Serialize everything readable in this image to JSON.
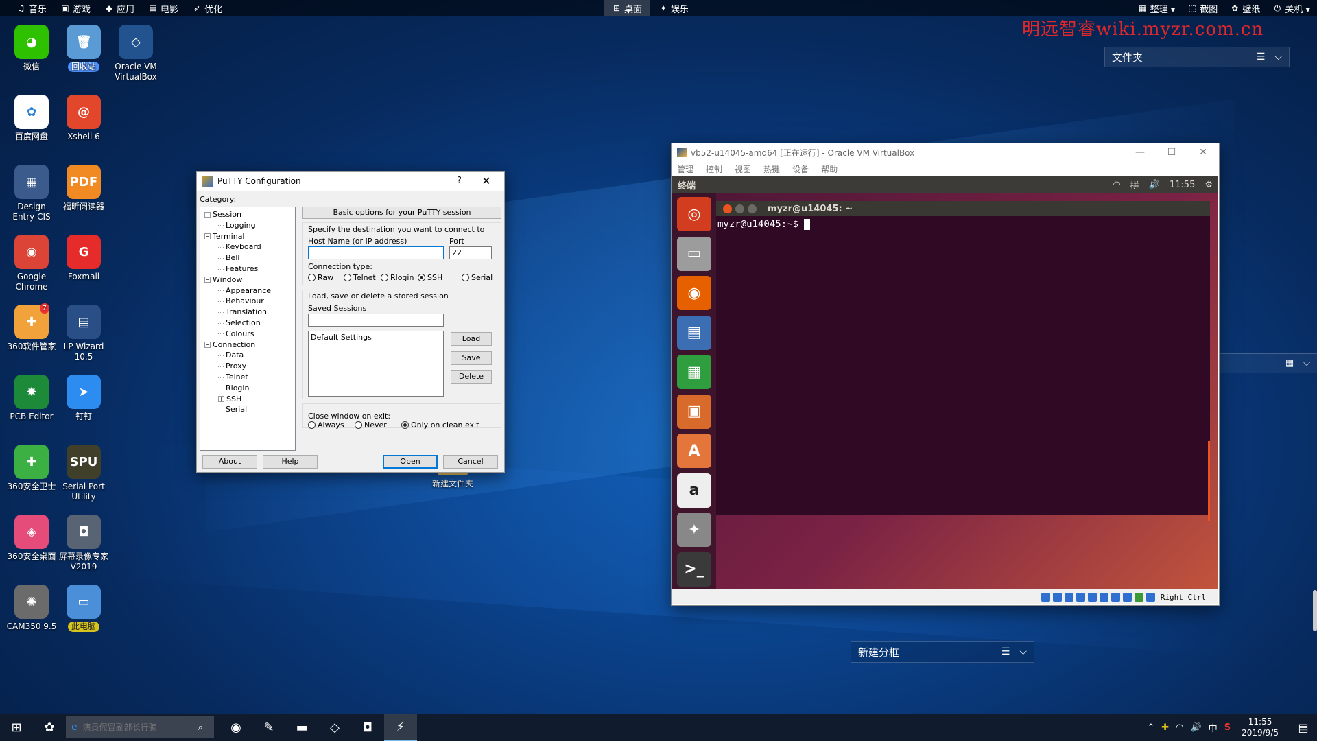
{
  "topbar": {
    "left_items": [
      {
        "icon": "music-note-icon",
        "glyph": "♫",
        "label": "音乐"
      },
      {
        "icon": "gamepad-icon",
        "glyph": "▣",
        "label": "游戏"
      },
      {
        "icon": "cube-icon",
        "glyph": "◆",
        "label": "应用"
      },
      {
        "icon": "film-icon",
        "glyph": "▤",
        "label": "电影"
      },
      {
        "icon": "rocket-icon",
        "glyph": "➶",
        "label": "优化"
      }
    ],
    "center_items": [
      {
        "icon": "windows-flag-icon",
        "glyph": "⊞",
        "label": "桌面",
        "active": true
      },
      {
        "icon": "star-icon",
        "glyph": "✦",
        "label": "娱乐",
        "active": false
      }
    ],
    "right_items": [
      {
        "icon": "organize-icon",
        "glyph": "▦",
        "label": "整理 ▾"
      },
      {
        "icon": "screenshot-icon",
        "glyph": "⬚",
        "label": "截图"
      },
      {
        "icon": "wallpaper-icon",
        "glyph": "✿",
        "label": "壁纸"
      },
      {
        "icon": "power-icon",
        "glyph": "⏻",
        "label": "关机 ▾"
      }
    ]
  },
  "watermark": "明远智睿wiki.myzr.com.cn",
  "folder_widget": {
    "label": "文件夹",
    "list_glyph": "☰",
    "chevron_glyph": "⌵"
  },
  "strip_widget": {
    "grid_glyph": "▦",
    "chevron_glyph": "⌵"
  },
  "split_widget": {
    "label": "新建分框",
    "list_glyph": "☰",
    "chevron_glyph": "⌵"
  },
  "desktop_icons": [
    {
      "name": "wechat",
      "label": "微信",
      "glyph": "◕",
      "color": "#2dc100",
      "highlight": ""
    },
    {
      "name": "recycle-bin",
      "label": "回收站",
      "glyph": "🗑",
      "color": "#5b9bd5",
      "highlight": "blue"
    },
    {
      "name": "oracle-vm-virtualbox",
      "label": "Oracle VM VirtualBox",
      "glyph": "◇",
      "color": "#23538e",
      "highlight": ""
    },
    {
      "name": "baidu-netdisk",
      "label": "百度网盘",
      "glyph": "✿",
      "color": "#ffffff",
      "highlight": ""
    },
    {
      "name": "xshell-6",
      "label": "Xshell 6",
      "glyph": "@",
      "color": "#e2462b",
      "highlight": ""
    },
    {
      "name": "design-entry-cis",
      "label": "Design Entry CIS",
      "glyph": "▦",
      "color": "#3b5b8c",
      "highlight": ""
    },
    {
      "name": "foxit-reader",
      "label": "福昕阅读器",
      "glyph": "PDF",
      "color": "#f28a24",
      "highlight": ""
    },
    {
      "name": "google-chrome",
      "label": "Google Chrome",
      "glyph": "◉",
      "color": "#db4437",
      "highlight": ""
    },
    {
      "name": "foxmail",
      "label": "Foxmail",
      "glyph": "G",
      "color": "#e62b2b",
      "highlight": ""
    },
    {
      "name": "360-software-manager",
      "label": "360软件管家",
      "glyph": "✚",
      "color": "#f2a23a",
      "highlight": "",
      "badge": "7"
    },
    {
      "name": "lp-wizard",
      "label": "LP Wizard 10.5",
      "glyph": "▤",
      "color": "#2a4f86",
      "highlight": ""
    },
    {
      "name": "pcb-editor",
      "label": "PCB Editor",
      "glyph": "✸",
      "color": "#1d8a3a",
      "highlight": ""
    },
    {
      "name": "dingtalk",
      "label": "钉钉",
      "glyph": "➤",
      "color": "#2d8cf0",
      "highlight": ""
    },
    {
      "name": "360-safeguard",
      "label": "360安全卫士",
      "glyph": "✚",
      "color": "#3cb043",
      "highlight": ""
    },
    {
      "name": "serial-port-utility",
      "label": "Serial Port Utility",
      "glyph": "SPU",
      "color": "#3f3f2a",
      "highlight": ""
    },
    {
      "name": "360-secure-desktop",
      "label": "360安全桌面",
      "glyph": "◈",
      "color": "#e54c7a",
      "highlight": ""
    },
    {
      "name": "screen-recorder",
      "label": "屏幕录像专家V2019",
      "glyph": "◘",
      "color": "#586373",
      "highlight": ""
    },
    {
      "name": "cam350",
      "label": "CAM350 9.5",
      "glyph": "✺",
      "color": "#6b6b6b",
      "highlight": ""
    },
    {
      "name": "this-pc",
      "label": "此电脑",
      "glyph": "▭",
      "color": "#4a8fd8",
      "highlight": "yellow"
    }
  ],
  "desktop_folder": {
    "label": "新建文件夹"
  },
  "putty": {
    "title": "PuTTY Configuration",
    "help_glyph": "?",
    "close_glyph": "✕",
    "category_label": "Category:",
    "tree": [
      {
        "label": "Session",
        "level": 0,
        "expander": "−"
      },
      {
        "label": "Logging",
        "level": 1,
        "expander": ""
      },
      {
        "label": "Terminal",
        "level": 0,
        "expander": "−"
      },
      {
        "label": "Keyboard",
        "level": 1,
        "expander": ""
      },
      {
        "label": "Bell",
        "level": 1,
        "expander": ""
      },
      {
        "label": "Features",
        "level": 1,
        "expander": ""
      },
      {
        "label": "Window",
        "level": 0,
        "expander": "−"
      },
      {
        "label": "Appearance",
        "level": 1,
        "expander": ""
      },
      {
        "label": "Behaviour",
        "level": 1,
        "expander": ""
      },
      {
        "label": "Translation",
        "level": 1,
        "expander": ""
      },
      {
        "label": "Selection",
        "level": 1,
        "expander": ""
      },
      {
        "label": "Colours",
        "level": 1,
        "expander": ""
      },
      {
        "label": "Connection",
        "level": 0,
        "expander": "−"
      },
      {
        "label": "Data",
        "level": 1,
        "expander": ""
      },
      {
        "label": "Proxy",
        "level": 1,
        "expander": ""
      },
      {
        "label": "Telnet",
        "level": 1,
        "expander": ""
      },
      {
        "label": "Rlogin",
        "level": 1,
        "expander": ""
      },
      {
        "label": "SSH",
        "level": 1,
        "expander": "+"
      },
      {
        "label": "Serial",
        "level": 1,
        "expander": ""
      }
    ],
    "header": "Basic options for your PuTTY session",
    "destination_label": "Specify the destination you want to connect to",
    "host_label": "Host Name (or IP address)",
    "host_value": "",
    "port_label": "Port",
    "port_value": "22",
    "conn_type_label": "Connection type:",
    "conn_types": [
      {
        "label": "Raw",
        "selected": false
      },
      {
        "label": "Telnet",
        "selected": false
      },
      {
        "label": "Rlogin",
        "selected": false
      },
      {
        "label": "SSH",
        "selected": true
      },
      {
        "label": "Serial",
        "selected": false
      }
    ],
    "sessions_group_label": "Load, save or delete a stored session",
    "saved_sessions_label": "Saved Sessions",
    "saved_sessions_value": "",
    "sessions_list": [
      "Default Settings"
    ],
    "load_label": "Load",
    "save_label": "Save",
    "delete_label": "Delete",
    "close_exit_label": "Close window on exit:",
    "close_options": [
      {
        "label": "Always",
        "selected": false
      },
      {
        "label": "Never",
        "selected": false
      },
      {
        "label": "Only on clean exit",
        "selected": true
      }
    ],
    "about_label": "About",
    "help_label": "Help",
    "open_label": "Open",
    "cancel_label": "Cancel"
  },
  "vbox": {
    "title": "vb52-u14045-amd64 [正在运行] - Oracle VM VirtualBox",
    "window_controls": {
      "minimize": "—",
      "maximize": "☐",
      "close": "✕"
    },
    "menu": [
      "管理",
      "控制",
      "视图",
      "热键",
      "设备",
      "帮助"
    ],
    "ubuntu_panel": {
      "title": "终端",
      "wifi_glyph": "◠",
      "keyboard_glyph": "拼",
      "volume_glyph": "🔊",
      "time": "11:55",
      "gear_glyph": "⚙"
    },
    "launcher": [
      {
        "name": "ubuntu-dash",
        "glyph": "◎",
        "color": "#d23c1f"
      },
      {
        "name": "files",
        "glyph": "▭",
        "color": "#9c9c9c"
      },
      {
        "name": "firefox",
        "glyph": "◉",
        "color": "#e66000"
      },
      {
        "name": "libreoffice-writer",
        "glyph": "▤",
        "color": "#3c6eb4"
      },
      {
        "name": "libreoffice-calc",
        "glyph": "▦",
        "color": "#2e9e3e"
      },
      {
        "name": "libreoffice-impress",
        "glyph": "▣",
        "color": "#d86b2b"
      },
      {
        "name": "ubuntu-software",
        "glyph": "A",
        "color": "#e4753b"
      },
      {
        "name": "amazon",
        "glyph": "a",
        "color": "#eeeeee"
      },
      {
        "name": "system-settings",
        "glyph": "✦",
        "color": "#888888"
      },
      {
        "name": "terminal",
        "glyph": ">_",
        "color": "#3a3a3a"
      }
    ],
    "terminal": {
      "title": "myzr@u14045: ~",
      "prompt": "myzr@u14045:~$"
    },
    "statusbar": {
      "host_key": "Right Ctrl"
    }
  },
  "taskbar": {
    "start_glyph": "⊞",
    "search_placeholder": "演员假冒副部长行骗",
    "search_glyph": "⌕",
    "pinned": [
      {
        "name": "360-browser",
        "glyph": "✿",
        "active": false
      },
      {
        "name": "chrome",
        "glyph": "◉",
        "active": false
      },
      {
        "name": "notepad",
        "glyph": "✎",
        "active": false
      },
      {
        "name": "file-explorer",
        "glyph": "▬",
        "active": false
      },
      {
        "name": "virtualbox",
        "glyph": "◇",
        "active": false
      },
      {
        "name": "video-recorder",
        "glyph": "◘",
        "active": false
      },
      {
        "name": "putty",
        "glyph": "⚡",
        "active": true
      }
    ],
    "tray": {
      "up_glyph": "⌃",
      "shield_glyph": "✚",
      "wifi_glyph": "◠",
      "volume_glyph": "🔊",
      "ime": "中",
      "sogou_glyph": "S",
      "time": "11:55",
      "date": "2019/9/5",
      "notification_glyph": "▤"
    }
  }
}
